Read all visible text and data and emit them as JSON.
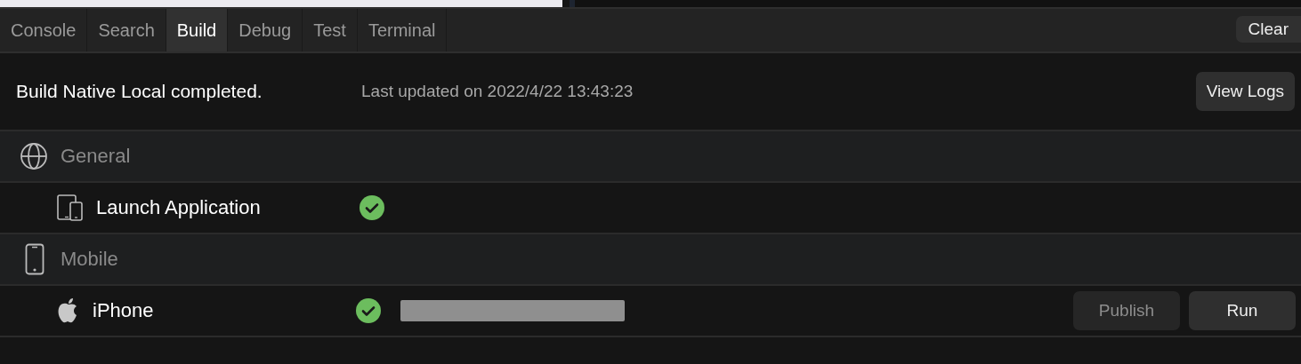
{
  "tabs": [
    {
      "label": "Console",
      "selected": false
    },
    {
      "label": "Search",
      "selected": false
    },
    {
      "label": "Build",
      "selected": true
    },
    {
      "label": "Debug",
      "selected": false
    },
    {
      "label": "Test",
      "selected": false
    },
    {
      "label": "Terminal",
      "selected": false
    }
  ],
  "clear_button": "Clear",
  "status": {
    "message": "Build Native Local completed.",
    "updated": "Last updated on 2022/4/22 13:43:23",
    "button": "View Logs"
  },
  "groups": [
    {
      "label": "General",
      "kind": "globe",
      "items": [
        {
          "label": "Launch Application",
          "kind": "devices",
          "succeeded": true,
          "redacted": false
        }
      ]
    },
    {
      "label": "Mobile",
      "kind": "phone",
      "items": [
        {
          "label": "iPhone",
          "kind": "apple",
          "succeeded": true,
          "redacted": true,
          "actions": [
            {
              "label": "Publish",
              "disabled": true
            },
            {
              "label": "Run",
              "disabled": false
            }
          ]
        }
      ]
    }
  ]
}
